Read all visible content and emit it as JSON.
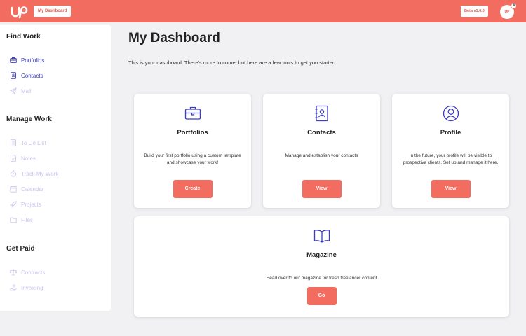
{
  "topbar": {
    "dashboard_button": "My Dashboard",
    "beta_badge": "Beta v1.0.0",
    "avatar_initials": "UP",
    "notification_count": "4"
  },
  "sidebar": {
    "find_work": {
      "title": "Find Work",
      "items": [
        {
          "label": "Portfolios",
          "icon": "briefcase-icon",
          "state": "active"
        },
        {
          "label": "Contacts",
          "icon": "contacts-book-icon",
          "state": "active"
        },
        {
          "label": "Mail",
          "icon": "paper-plane-icon",
          "state": "disabled"
        }
      ]
    },
    "manage_work": {
      "title": "Manage Work",
      "items": [
        {
          "label": "To Do List",
          "icon": "checklist-icon",
          "state": "disabled"
        },
        {
          "label": "Notes",
          "icon": "notes-icon",
          "state": "disabled"
        },
        {
          "label": "Track My Work",
          "icon": "stopwatch-icon",
          "state": "disabled"
        },
        {
          "label": "Calendar",
          "icon": "calendar-icon",
          "state": "disabled"
        },
        {
          "label": "Projects",
          "icon": "rocket-icon",
          "state": "disabled"
        },
        {
          "label": "Files",
          "icon": "folder-icon",
          "state": "disabled"
        }
      ]
    },
    "get_paid": {
      "title": "Get Paid",
      "items": [
        {
          "label": "Contracts",
          "icon": "scales-icon",
          "state": "disabled"
        },
        {
          "label": "Invoicing",
          "icon": "hand-coin-icon",
          "state": "disabled"
        }
      ]
    }
  },
  "main": {
    "title": "My Dashboard",
    "intro": "This is your dashboard. There's more to come, but here are a few tools to get you started.",
    "cards": [
      {
        "title": "Portfolios",
        "description": "Build your first portfolio using a custom template and showcase your work!",
        "button": "Create",
        "icon": "briefcase-icon"
      },
      {
        "title": "Contacts",
        "description": "Manage and establish your contacts",
        "button": "View",
        "icon": "contacts-book-icon"
      },
      {
        "title": "Profile",
        "description": "In the future, your profile will be visible to prospective clients. Set up and manage it here.",
        "button": "View",
        "icon": "user-circle-icon"
      },
      {
        "title": "Magazine",
        "description": "Head over to our magazine for fresh freelancer content",
        "button": "Go",
        "icon": "open-book-icon"
      }
    ]
  },
  "colors": {
    "brand": "#f26d5f",
    "nav_active": "#3a3bc4",
    "nav_disabled": "#c7c6ee",
    "background": "#f1f1f3"
  }
}
